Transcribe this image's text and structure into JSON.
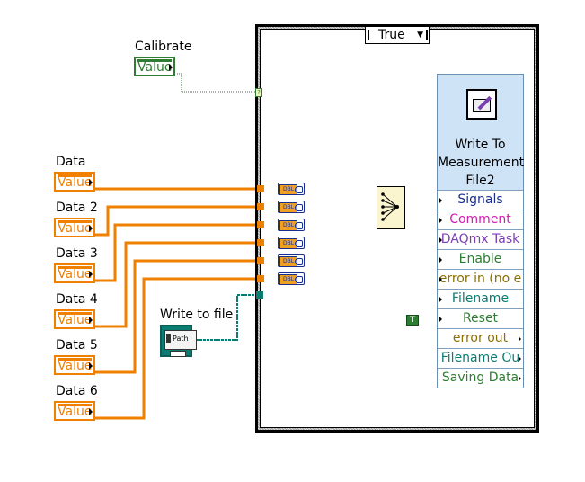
{
  "case_structure": {
    "selector_value": "True"
  },
  "controls": {
    "calibrate": {
      "label": "Calibrate",
      "value_text": "Value"
    },
    "data": [
      {
        "label": "Data",
        "value_text": "Value"
      },
      {
        "label": "Data 2",
        "value_text": "Value"
      },
      {
        "label": "Data 3",
        "value_text": "Value"
      },
      {
        "label": "Data 4",
        "value_text": "Value"
      },
      {
        "label": "Data 5",
        "value_text": "Value"
      },
      {
        "label": "Data 6",
        "value_text": "Value"
      }
    ],
    "write_to_file": {
      "label": "Write to file",
      "path_text": "Path"
    }
  },
  "express_vi": {
    "title": "Write To Measurement File2",
    "terminals": [
      {
        "label": "Signals",
        "color": "#1a2e8f"
      },
      {
        "label": "Comment",
        "color": "#d020b0"
      },
      {
        "label": "DAQmx Task",
        "color": "#7a3fb0"
      },
      {
        "label": "Enable",
        "color": "#2e7d32"
      },
      {
        "label": "error in (no e",
        "color": "#8a7000"
      },
      {
        "label": "Filename",
        "color": "#0b7c72"
      },
      {
        "label": "Reset",
        "color": "#2e7d32"
      },
      {
        "label": "error out",
        "color": "#8a7000"
      },
      {
        "label": "Filename Ou",
        "color": "#0b7c72"
      },
      {
        "label": "Saving Data",
        "color": "#2e7d32"
      }
    ]
  },
  "constants": {
    "true_label": "T"
  },
  "colors": {
    "numeric": "#f08000",
    "boolean": "#2e7d32",
    "path": "#0b7c72",
    "dynamic": "#1a2e8f"
  }
}
